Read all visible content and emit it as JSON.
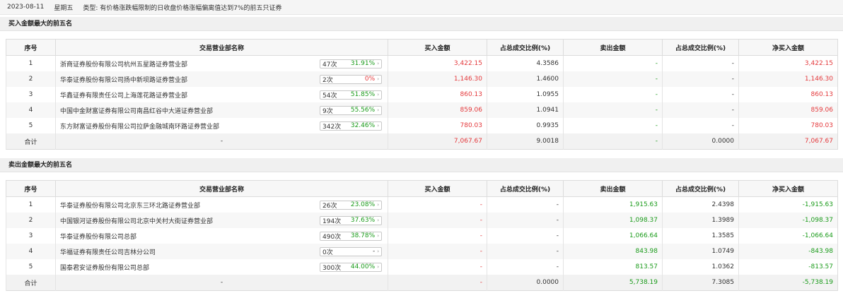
{
  "header": {
    "date": "2023-08-11",
    "weekday": "星期五",
    "type_label": "类型:",
    "type_text": "有价格涨跌幅限制的日收盘价格涨幅偏离值达到7%的前五只证券"
  },
  "columns": [
    "序号",
    "交易营业部名称",
    "买入金额",
    "占总成交比例(%)",
    "卖出金额",
    "占总成交比例(%)",
    "净买入金额"
  ],
  "buy": {
    "title": "买入金额最大的前五名",
    "rows": [
      {
        "no": "1",
        "name": "浙商证券股份有限公司杭州五星路证券营业部",
        "count": "47次",
        "ratio": "31.91%",
        "buy": "3,422.15",
        "buy_pct": "4.3586",
        "sell": "-",
        "sell_pct": "-",
        "net": "3,422.15"
      },
      {
        "no": "2",
        "name": "华泰证券股份有限公司扬中新坝路证券营业部",
        "count": "2次",
        "ratio": "0%",
        "buy": "1,146.30",
        "buy_pct": "1.4600",
        "sell": "-",
        "sell_pct": "-",
        "net": "1,146.30"
      },
      {
        "no": "3",
        "name": "华鑫证券有限责任公司上海莲花路证券营业部",
        "count": "54次",
        "ratio": "51.85%",
        "buy": "860.13",
        "buy_pct": "1.0955",
        "sell": "-",
        "sell_pct": "-",
        "net": "860.13"
      },
      {
        "no": "4",
        "name": "中国中金财富证券有限公司南昌红谷中大道证券营业部",
        "count": "9次",
        "ratio": "55.56%",
        "buy": "859.06",
        "buy_pct": "1.0941",
        "sell": "-",
        "sell_pct": "-",
        "net": "859.06"
      },
      {
        "no": "5",
        "name": "东方财富证券股份有限公司拉萨金融城南环路证券营业部",
        "count": "342次",
        "ratio": "32.46%",
        "buy": "780.03",
        "buy_pct": "0.9935",
        "sell": "-",
        "sell_pct": "-",
        "net": "780.03"
      }
    ],
    "total": {
      "label": "合计",
      "name": "-",
      "buy": "7,067.67",
      "buy_pct": "9.0018",
      "sell": "-",
      "sell_pct": "0.0000",
      "net": "7,067.67"
    }
  },
  "sell": {
    "title": "卖出金额最大的前五名",
    "rows": [
      {
        "no": "1",
        "name": "华泰证券股份有限公司北京东三环北路证券营业部",
        "count": "26次",
        "ratio": "23.08%",
        "buy": "-",
        "buy_pct": "-",
        "sell": "1,915.63",
        "sell_pct": "2.4398",
        "net": "-1,915.63"
      },
      {
        "no": "2",
        "name": "中国银河证券股份有限公司北京中关村大街证券营业部",
        "count": "194次",
        "ratio": "37.63%",
        "buy": "-",
        "buy_pct": "-",
        "sell": "1,098.37",
        "sell_pct": "1.3989",
        "net": "-1,098.37"
      },
      {
        "no": "3",
        "name": "华泰证券股份有限公司总部",
        "count": "490次",
        "ratio": "38.78%",
        "buy": "-",
        "buy_pct": "-",
        "sell": "1,066.64",
        "sell_pct": "1.3585",
        "net": "-1,066.64"
      },
      {
        "no": "4",
        "name": "华福证券有限责任公司吉林分公司",
        "count": "0次",
        "ratio": "-",
        "buy": "-",
        "buy_pct": "-",
        "sell": "843.98",
        "sell_pct": "1.0749",
        "net": "-843.98"
      },
      {
        "no": "5",
        "name": "国泰君安证券股份有限公司总部",
        "count": "300次",
        "ratio": "44.00%",
        "buy": "-",
        "buy_pct": "-",
        "sell": "813.57",
        "sell_pct": "1.0362",
        "net": "-813.57"
      }
    ],
    "total": {
      "label": "合计",
      "name": "-",
      "buy": "-",
      "buy_pct": "0.0000",
      "sell": "5,738.19",
      "sell_pct": "7.3085",
      "net": "-5,738.19"
    }
  },
  "colors": {
    "red": "#e4393c",
    "green": "#1a9b1a"
  },
  "icons": {
    "pill_arrow": "chevron-right-icon"
  }
}
